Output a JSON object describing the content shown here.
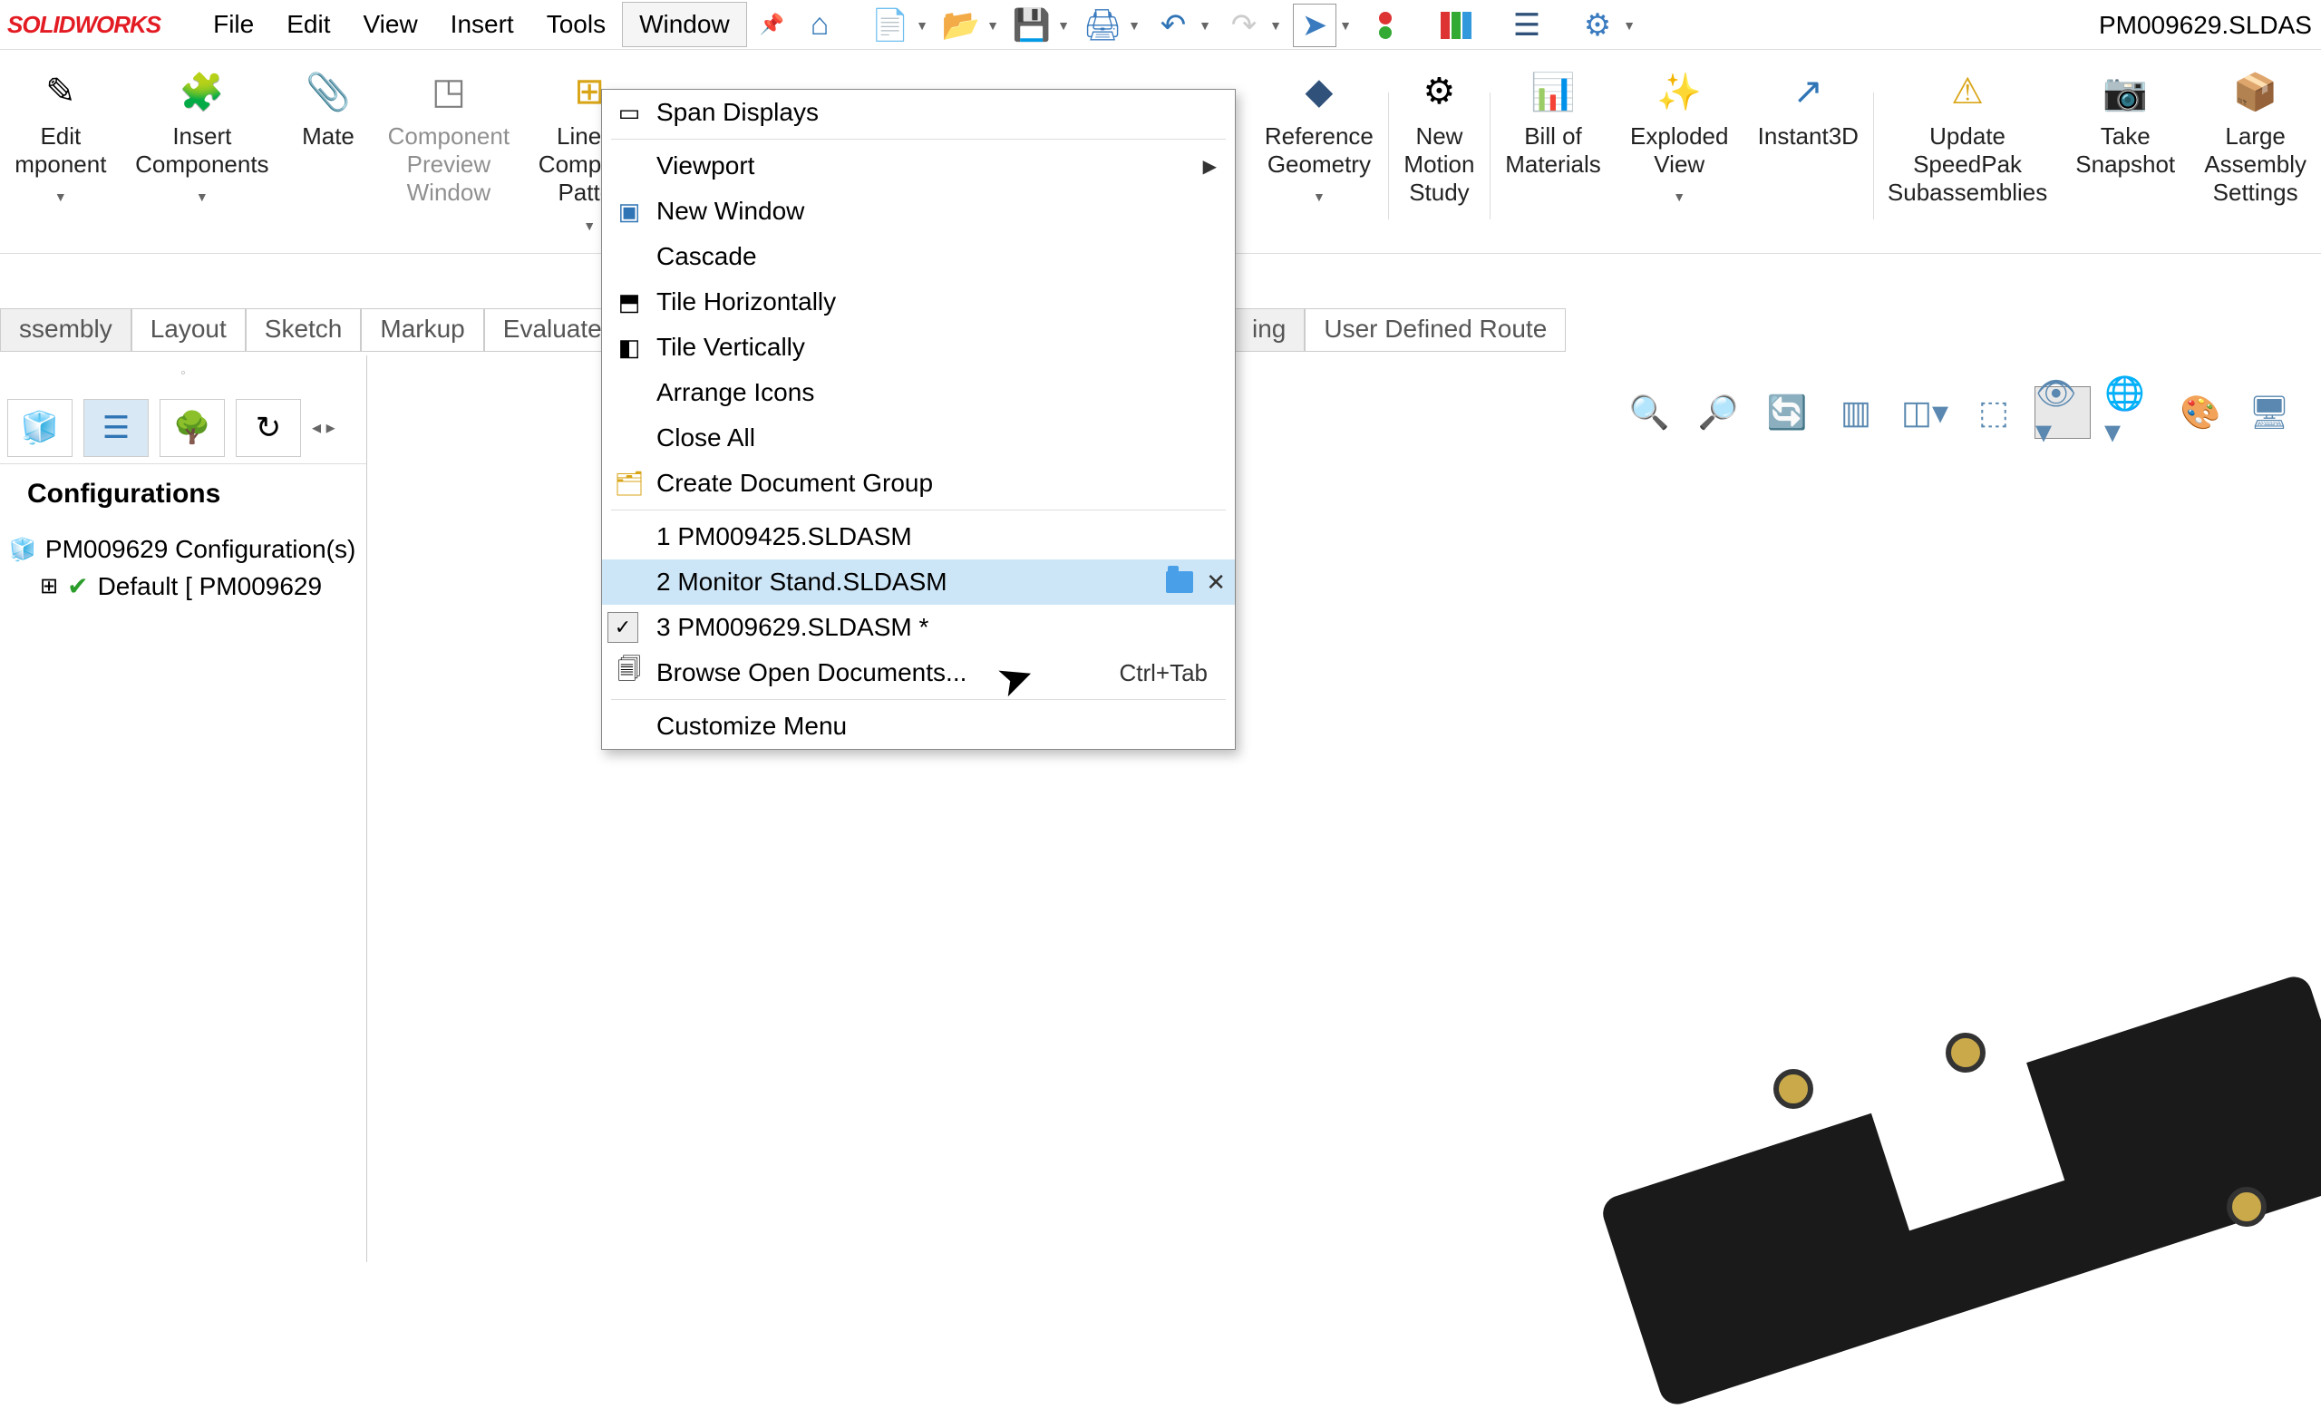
{
  "app": {
    "logo": "SOLIDWORKS",
    "doc_title": "PM009629.SLDAS"
  },
  "menu": {
    "file": "File",
    "edit": "Edit",
    "view": "View",
    "insert": "Insert",
    "tools": "Tools",
    "window": "Window"
  },
  "ribbon": {
    "edit_component": "Edit\nmponent",
    "insert_components": "Insert\nComponents",
    "mate": "Mate",
    "component_preview": "Component\nPreview\nWindow",
    "linear_pattern": "Linear\nCompone\nPatter",
    "reference_geometry": "Reference\nGeometry",
    "new_motion_study": "New\nMotion\nStudy",
    "bom": "Bill of\nMaterials",
    "exploded_view": "Exploded\nView",
    "instant3d": "Instant3D",
    "update_speedpak": "Update\nSpeedPak\nSubassemblies",
    "take_snapshot": "Take\nSnapshot",
    "large_assembly": "Large\nAssembly\nSettings"
  },
  "tabs": {
    "assembly": "ssembly",
    "layout": "Layout",
    "sketch": "Sketch",
    "markup": "Markup",
    "evaluate": "Evaluate",
    "ing": "ing",
    "user_route": "User Defined Route"
  },
  "window_menu": {
    "span": "Span Displays",
    "viewport": "Viewport",
    "new_window": "New Window",
    "cascade": "Cascade",
    "tile_h": "Tile Horizontally",
    "tile_v": "Tile Vertically",
    "arrange": "Arrange Icons",
    "close_all": "Close All",
    "create_group": "Create Document Group",
    "doc1": "1 PM009425.SLDASM",
    "doc2": "2 Monitor Stand.SLDASM",
    "doc3": "3 PM009629.SLDASM *",
    "browse": "Browse Open Documents...",
    "browse_shortcut": "Ctrl+Tab",
    "customize": "Customize Menu"
  },
  "left_panel": {
    "header": "Configurations",
    "root": "PM009629 Configuration(s)",
    "default": "Default [ PM009629"
  }
}
